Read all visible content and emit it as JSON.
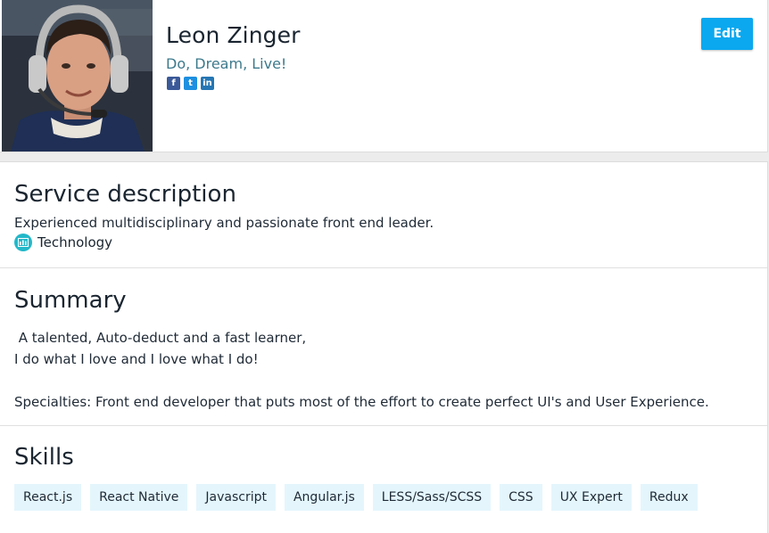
{
  "profile": {
    "name": "Leon Zinger",
    "tagline": "Do, Dream, Live!",
    "social": [
      {
        "name": "facebook-icon",
        "glyph": "f"
      },
      {
        "name": "twitter-icon",
        "glyph": "t"
      },
      {
        "name": "linkedin-icon",
        "glyph": "in"
      }
    ],
    "edit_label": "Edit"
  },
  "service": {
    "title": "Service description",
    "description": "Experienced multidisciplinary and passionate front end leader.",
    "category": "Technology"
  },
  "summary": {
    "title": "Summary",
    "text": " A talented, Auto-deduct and a fast learner,\nI do what I love and I love what I do!\n\nSpecialties: Front end developer that puts most of the effort to create perfect UI's and User Experience."
  },
  "skills": {
    "title": "Skills",
    "items": [
      "React.js",
      "React Native",
      "Javascript",
      "Angular.js",
      "LESS/Sass/SCSS",
      "CSS",
      "UX Expert",
      "Redux"
    ]
  },
  "colors": {
    "accent": "#0ba8ef",
    "tagline": "#3d7a8c",
    "skill_bg": "#e4f6fc",
    "category_icon": "#22b8c9"
  }
}
